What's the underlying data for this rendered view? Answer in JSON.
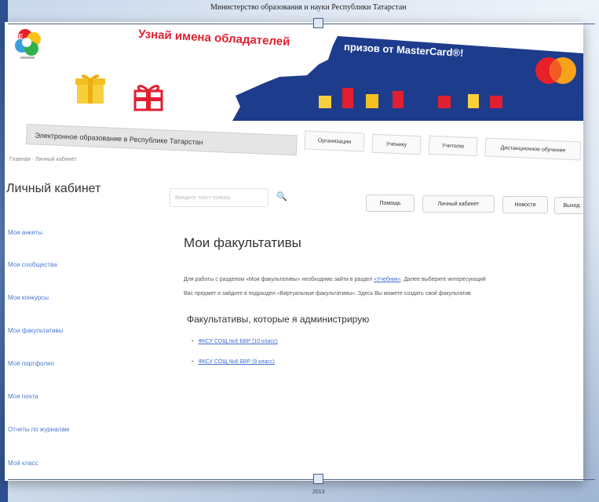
{
  "slide": {
    "top_caption": "Министерство образования и науки Республики Татарстан",
    "bottom_caption": "2013"
  },
  "banner": {
    "promo_left": "Узнай имена обладателей",
    "promo_right": "призов от MasterCard®!",
    "mastercard_label": "MasterCard",
    "colors": {
      "red": "#e02030",
      "blue": "#1e3c8c",
      "mc_red": "#e8202a",
      "mc_orange": "#f7a21b"
    }
  },
  "nav": {
    "main": "Электронное образование в Республике Татарстан",
    "tabs": [
      "Организации",
      "Ученику",
      "Учителю",
      "Дистанционное обучение"
    ]
  },
  "breadcrumb": "Главная · Личный кабинет",
  "sidebar": {
    "title": "Личный кабинет",
    "items": [
      "Мои анкеты",
      "Мои сообщества",
      "Мои конкурсы",
      "Мои факультативы",
      "Моё портфолио",
      "Моя почта",
      "Отчеты по журналам",
      "Мой класс"
    ]
  },
  "search": {
    "placeholder": "Введите текст поиска"
  },
  "top_buttons": [
    "Помощь",
    "Личный кабинет",
    "Новости",
    "Выход"
  ],
  "main": {
    "title": "Мои факультативы",
    "desc_line1_a": "Для работы с разделом «Мои факультативы» необходимо зайти в раздел",
    "desc_link": "«Учебник»",
    "desc_line1_b": ". Далее выберите интересующий",
    "desc_line2": "Вас предмет и зайдите в подраздел «Виртуальные факультативы». Здесь Вы можете создать свой факультатив",
    "subtitle": "Факультативы, которые я администрирую",
    "courses": [
      "ФКСУ СОЩ №6 БВР (10 класс)",
      "ФКСУ СОЩ №6 БВР (9 класс)"
    ]
  }
}
